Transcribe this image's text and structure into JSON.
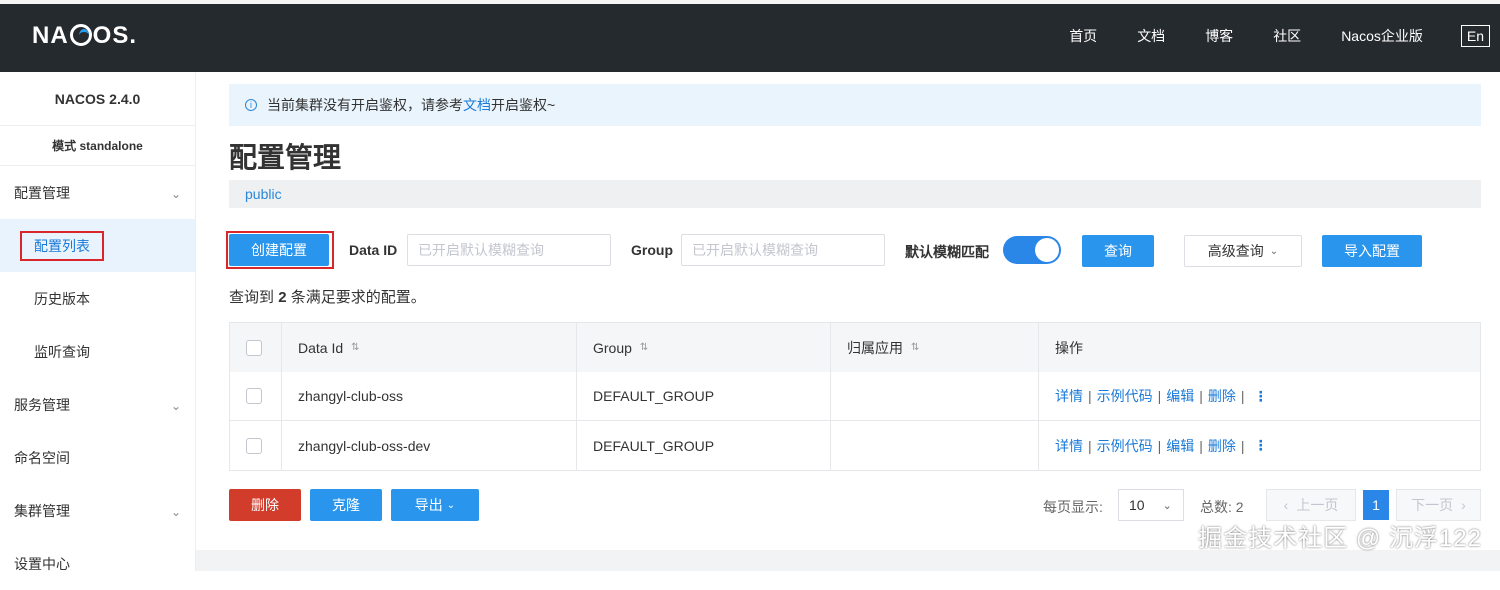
{
  "header": {
    "logo": "NACOS.",
    "nav": [
      "首页",
      "文档",
      "博客",
      "社区",
      "Nacos企业版"
    ],
    "lang": "En"
  },
  "sidebar": {
    "version": "NACOS 2.4.0",
    "mode": "模式 standalone",
    "groups": [
      {
        "label": "配置管理",
        "items": [
          "配置列表",
          "历史版本",
          "监听查询"
        ]
      },
      {
        "label": "服务管理"
      },
      {
        "label": "命名空间"
      },
      {
        "label": "集群管理"
      },
      {
        "label": "设置中心"
      }
    ]
  },
  "notice": {
    "prefix": "当前集群没有开启鉴权，请参考",
    "link": "文档",
    "suffix": "开启鉴权~"
  },
  "page_title": "配置管理",
  "namespace": "public",
  "toolbar": {
    "create": "创建配置",
    "data_id_label": "Data ID",
    "data_id_placeholder": "已开启默认模糊查询",
    "group_label": "Group",
    "group_placeholder": "已开启默认模糊查询",
    "fuzzy_label": "默认模糊匹配",
    "query": "查询",
    "advanced": "高级查询",
    "import": "导入配置"
  },
  "result": {
    "prefix": "查询到",
    "count": "2",
    "suffix": "条满足要求的配置。"
  },
  "table": {
    "headers": [
      "Data Id",
      "Group",
      "归属应用",
      "操作"
    ],
    "rows": [
      {
        "data_id": "zhangyl-club-oss",
        "group": "DEFAULT_GROUP",
        "app": ""
      },
      {
        "data_id": "zhangyl-club-oss-dev",
        "group": "DEFAULT_GROUP",
        "app": ""
      }
    ],
    "ops": [
      "详情",
      "示例代码",
      "编辑",
      "删除"
    ]
  },
  "bottom": {
    "delete": "删除",
    "clone": "克隆",
    "export": "导出",
    "page_size_label": "每页显示:",
    "page_size": "10",
    "total_label": "总数: 2",
    "prev": "上一页",
    "current_page": "1",
    "next": "下一页"
  },
  "watermark": "掘金技术社区 @ 沉浮122"
}
